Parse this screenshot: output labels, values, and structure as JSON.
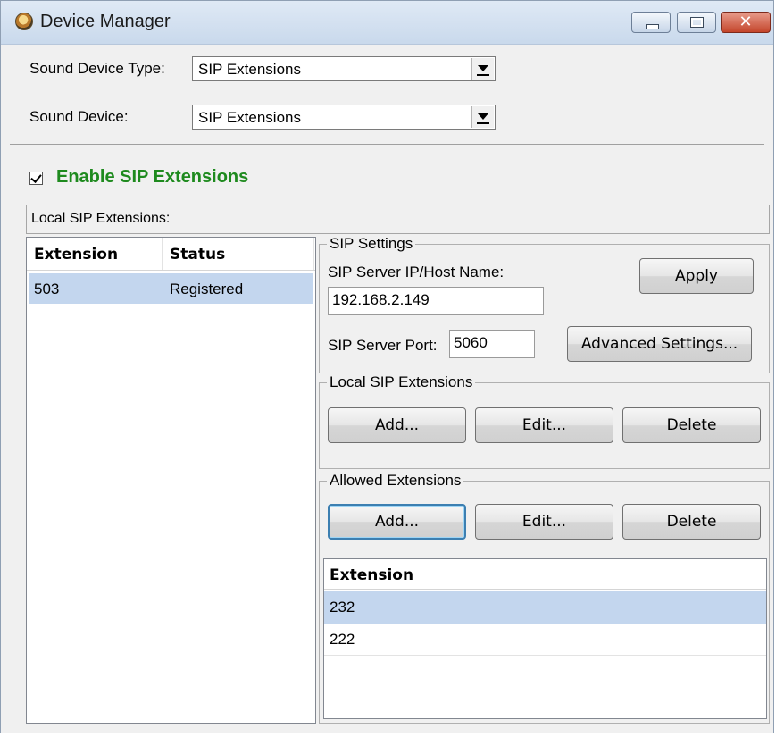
{
  "window": {
    "title": "Device Manager",
    "icon": "app-headset-icon",
    "controls": [
      "minimize-icon",
      "maximize-icon",
      "close-icon"
    ],
    "close_glyph": "✕"
  },
  "sound": {
    "device_type_label": "Sound Device Type:",
    "device_type_value": "SIP Extensions",
    "device_label": "Sound Device:",
    "device_value": "SIP Extensions"
  },
  "enable": {
    "checked": true,
    "label": "Enable SIP Extensions",
    "label_color": "#1e8a1e"
  },
  "local_extensions": {
    "header": "Local SIP Extensions:",
    "columns": [
      "Extension",
      "Status"
    ],
    "rows": [
      {
        "extension": "503",
        "status": "Registered",
        "selected": true
      }
    ]
  },
  "sip_settings": {
    "title": "SIP Settings",
    "server_label": "SIP Server IP/Host Name:",
    "server_value": "192.168.2.149",
    "port_label": "SIP Server Port:",
    "port_value": "5060",
    "apply_label": "Apply",
    "advanced_label": "Advanced Settings..."
  },
  "local_group": {
    "title": "Local SIP Extensions",
    "add_label": "Add...",
    "edit_label": "Edit...",
    "delete_label": "Delete"
  },
  "allowed_group": {
    "title": "Allowed Extensions",
    "add_label": "Add...",
    "edit_label": "Edit...",
    "delete_label": "Delete",
    "column": "Extension",
    "rows": [
      {
        "extension": "232",
        "selected": true
      },
      {
        "extension": "222",
        "selected": false
      }
    ]
  },
  "colors": {
    "selection": "#c3d6ee",
    "window_bg": "#f0f0f0"
  }
}
